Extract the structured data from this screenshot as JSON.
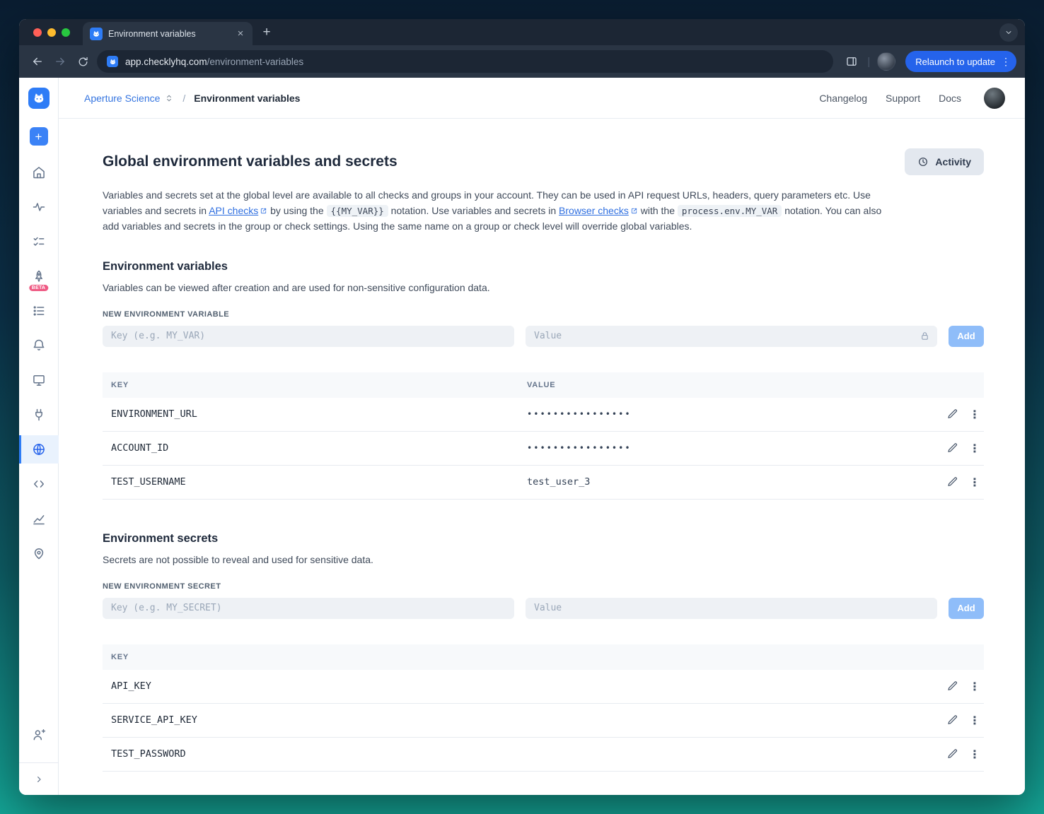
{
  "colors": {
    "brand_blue": "#2e7cf6",
    "accent_blue": "#2563eb",
    "add_button_bg": "#8fbdf9",
    "sidebar_active_bg": "#e9f2fd",
    "beta_badge_bg": "#ef5b84"
  },
  "browser": {
    "tab_title": "Environment variables",
    "url_domain": "app.checklyhq.com",
    "url_path": "/environment-variables",
    "relaunch_label": "Relaunch to update"
  },
  "glyphs": {
    "close": "×",
    "new_tab": "+",
    "plus": "+",
    "kebab": "⋮",
    "divider": "|"
  },
  "sidebar": {
    "beta_badge": "BETA",
    "icons": [
      "checkly-logo",
      "create-new",
      "home",
      "activity",
      "checks",
      "traces-beta",
      "test-sessions",
      "alerts",
      "dashboards",
      "maintenance-windows",
      "environment-globe",
      "snippets",
      "analytics",
      "locations",
      "invite-user",
      "collapse-sidebar"
    ],
    "active_icon": "environment-globe"
  },
  "app_header": {
    "account_name": "Aperture Science",
    "separator": "/",
    "page_title": "Environment variables",
    "links": [
      "Changelog",
      "Support",
      "Docs"
    ]
  },
  "page": {
    "title": "Global environment variables and secrets",
    "activity_button": "Activity",
    "intro": {
      "part1": "Variables and secrets set at the global level are available to all checks and groups in your account. They can be used in API request URLs, headers, query parameters etc. Use variables and secrets in ",
      "link_api_checks": "API checks",
      "part2": " by using the ",
      "code_my_var": "{{MY_VAR}}",
      "part3": " notation. Use variables and secrets in ",
      "link_browser_checks": "Browser checks",
      "part4": " with the ",
      "code_process_env": "process.env.MY_VAR",
      "part5": " notation. You can also add variables and secrets in the group or check settings. Using the same name on a group or check level will override global variables."
    }
  },
  "variables_section": {
    "heading": "Environment variables",
    "description": "Variables can be viewed after creation and are used for non-sensitive configuration data.",
    "form_label": "NEW ENVIRONMENT VARIABLE",
    "key_placeholder": "Key (e.g. MY_VAR)",
    "value_placeholder": "Value",
    "add_label": "Add",
    "table": {
      "key_header": "KEY",
      "value_header": "VALUE",
      "rows": [
        {
          "key": "ENVIRONMENT_URL",
          "value": "••••••••••••••••",
          "masked": true
        },
        {
          "key": "ACCOUNT_ID",
          "value": "••••••••••••••••",
          "masked": true
        },
        {
          "key": "TEST_USERNAME",
          "value": "test_user_3",
          "masked": false
        }
      ]
    }
  },
  "secrets_section": {
    "heading": "Environment secrets",
    "description": "Secrets are not possible to reveal and used for sensitive data.",
    "form_label": "NEW ENVIRONMENT SECRET",
    "key_placeholder": "Key (e.g. MY_SECRET)",
    "value_placeholder": "Value",
    "add_label": "Add",
    "table": {
      "key_header": "KEY",
      "rows": [
        {
          "key": "API_KEY"
        },
        {
          "key": "SERVICE_API_KEY"
        },
        {
          "key": "TEST_PASSWORD"
        }
      ]
    }
  }
}
